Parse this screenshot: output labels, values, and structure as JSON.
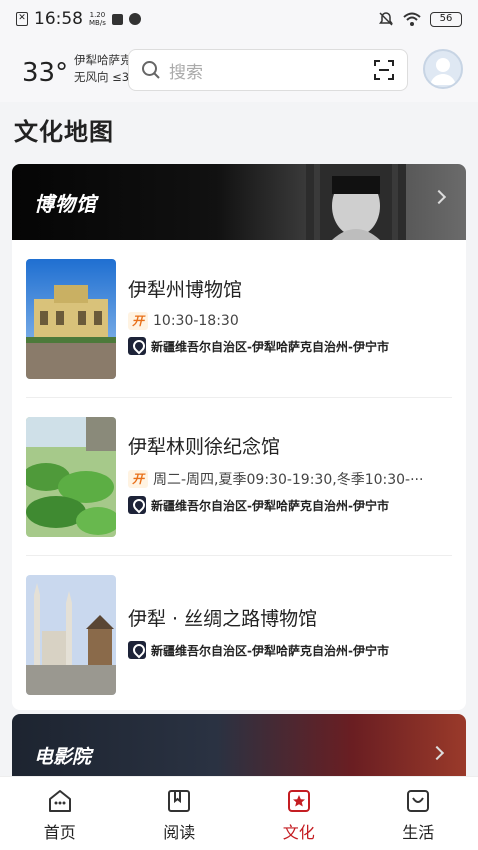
{
  "status_bar": {
    "time": "16:58",
    "net_speed_value": "1.20",
    "net_speed_unit": "MB/s",
    "battery": "56"
  },
  "header": {
    "temperature": "33°",
    "location": "伊犁哈萨克自治州",
    "wind": "无风向 ≤3",
    "search_placeholder": "搜索"
  },
  "page_title": "文化地图",
  "museum_card": {
    "title": "博物馆",
    "items": [
      {
        "name": "伊犁州博物馆",
        "hours": "10:30-18:30",
        "address": "新疆维吾尔自治区-伊犁哈萨克自治州-伊宁市"
      },
      {
        "name": "伊犁林则徐纪念馆",
        "hours": "周二-周四,夏季09:30-19:30,冬季10:30-···",
        "address": "新疆维吾尔自治区-伊犁哈萨克自治州-伊宁市"
      },
      {
        "name": "伊犁 · 丝绸之路博物馆",
        "hours": "",
        "address": "新疆维吾尔自治区-伊犁哈萨克自治州-伊宁市"
      }
    ],
    "open_tag": "开"
  },
  "cinema_card": {
    "title": "电影院"
  },
  "tabbar": {
    "tabs": [
      {
        "label": "首页",
        "icon": "home-icon"
      },
      {
        "label": "阅读",
        "icon": "book-icon"
      },
      {
        "label": "文化",
        "icon": "culture-icon"
      },
      {
        "label": "生活",
        "icon": "life-icon"
      }
    ],
    "active": "文化",
    "active_color": "#c41d22"
  }
}
